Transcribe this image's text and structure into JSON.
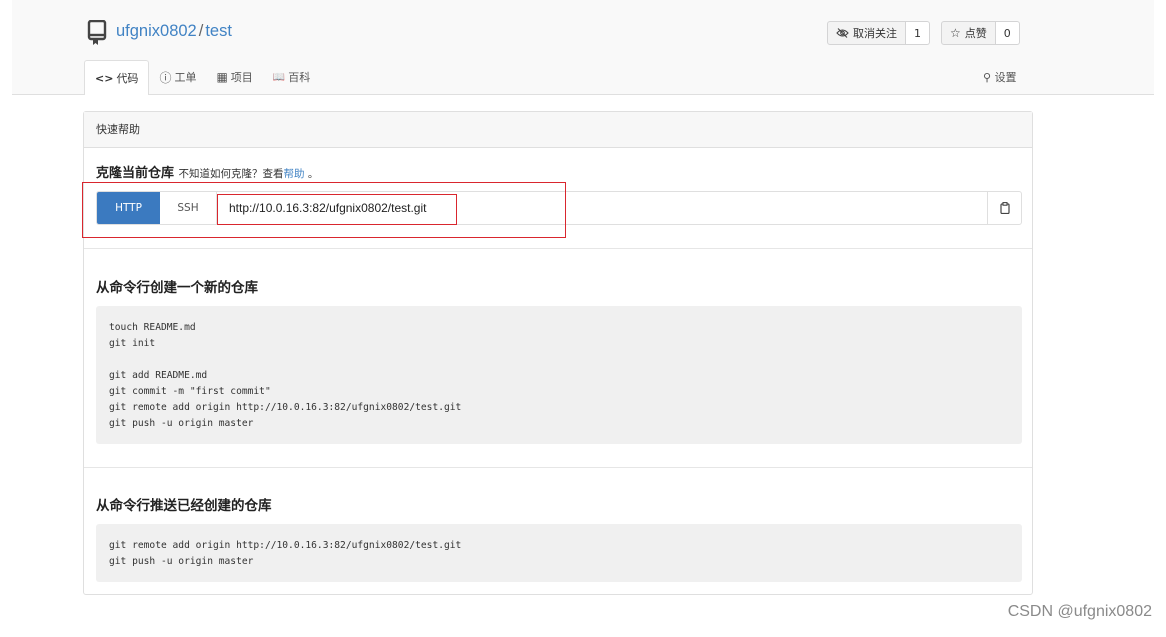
{
  "repo": {
    "owner": "ufgnix0802",
    "separator": "/",
    "name": "test"
  },
  "header_buttons": {
    "unwatch": {
      "label": "取消关注",
      "count": "1"
    },
    "star": {
      "label": "点赞",
      "count": "0"
    }
  },
  "tabs": [
    {
      "icon": "<>",
      "label": "代码"
    },
    {
      "icon": "ⓘ",
      "label": "工单"
    },
    {
      "icon": "▦",
      "label": "项目"
    },
    {
      "icon": "📖",
      "label": "百科"
    }
  ],
  "settings_label": "设置",
  "panel": {
    "title": "快速帮助",
    "clone": {
      "heading": "克隆当前仓库",
      "hint_prefix": "不知道如何克隆？查看",
      "hint_link": "帮助",
      "hint_suffix": "。",
      "protocols": [
        "HTTP",
        "SSH"
      ],
      "active_protocol": "HTTP",
      "url": "http://10.0.16.3:82/ufgnix0802/test.git"
    },
    "new_repo": {
      "heading": "从命令行创建一个新的仓库",
      "code": "touch README.md\ngit init\n\ngit add README.md\ngit commit -m \"first commit\"\ngit remote add origin http://10.0.16.3:82/ufgnix0802/test.git\ngit push -u origin master"
    },
    "existing_repo": {
      "heading": "从命令行推送已经创建的仓库",
      "code": "git remote add origin http://10.0.16.3:82/ufgnix0802/test.git\ngit push -u origin master"
    }
  },
  "watermark": "CSDN @ufgnix0802",
  "colors": {
    "accent": "#3b7ac0",
    "link": "#4183c4",
    "highlight": "#d9262e"
  }
}
